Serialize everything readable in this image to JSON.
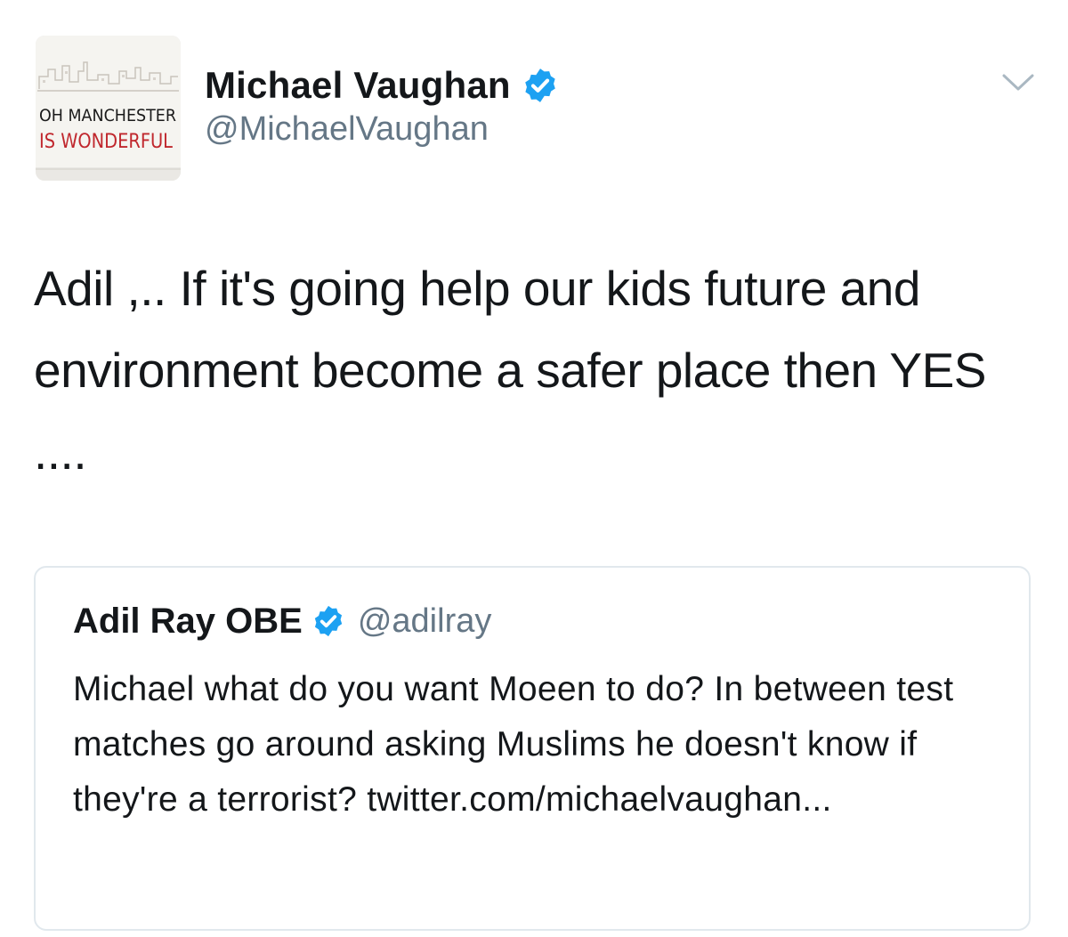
{
  "tweet": {
    "author_name": "Michael Vaughan",
    "author_handle": "@MichaelVaughan",
    "verified": true,
    "avatar": {
      "line1": "OH MANCHESTER",
      "line2": "IS WONDERFUL"
    },
    "text": "Adil ,.. If it's going help our kids future and environment become a safer place then YES ....",
    "menu_icon": "chevron-down-icon"
  },
  "quoted_tweet": {
    "author_name": "Adil Ray OBE",
    "author_handle": "@adilray",
    "verified": true,
    "text": "Michael what do you want Moeen to do? In between test matches go around asking Muslims he doesn't know if they're a terrorist? twitter.com/michaelvaughan..."
  },
  "colors": {
    "verified_blue": "#1da1f2",
    "secondary_text": "#657786",
    "border": "#e1e8ed",
    "avatar_red": "#c0272d"
  }
}
